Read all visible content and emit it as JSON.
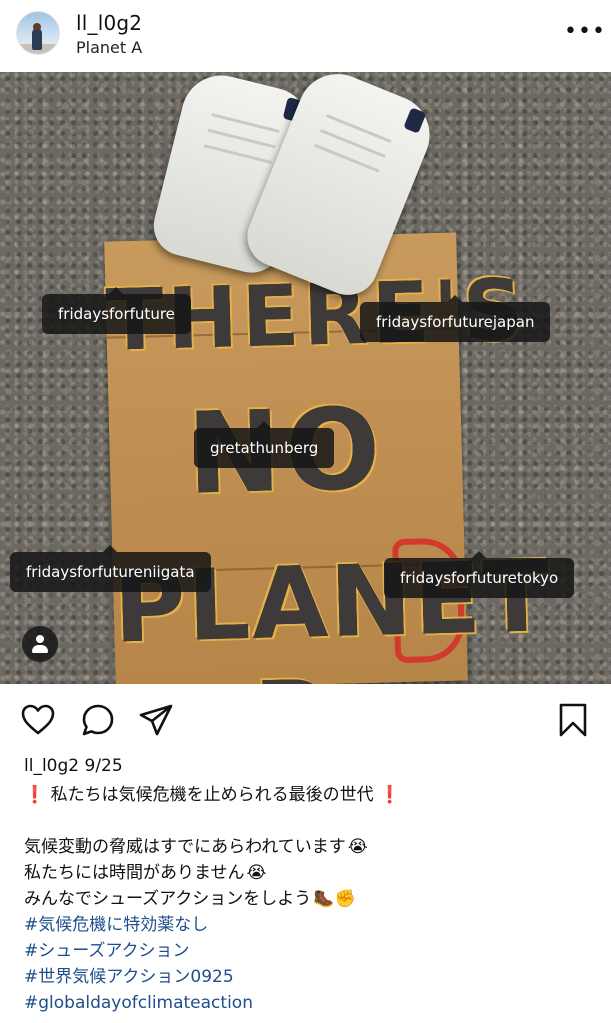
{
  "post": {
    "username": "ll_l0g2",
    "location": "Planet A",
    "more_label": "•••",
    "date": "9/25"
  },
  "photo": {
    "sign_lines": [
      "THERE'S",
      "NO",
      "PLANET B"
    ],
    "tags": [
      "fridaysforfuture",
      "fridaysforfuturejapan",
      "gretathunberg",
      "fridaysforfutureniigata",
      "fridaysforfuturetokyo"
    ],
    "user_tag_icon": "person-icon"
  },
  "actions": {
    "icons": [
      "heart-icon",
      "comment-icon",
      "share-icon",
      "bookmark-icon"
    ]
  },
  "caption": {
    "headline_mark": "❗",
    "headline": "私たちは気候危機を止められる最後の世代",
    "lines": [
      {
        "text": "気候変動の脅威はすでにあらわれています",
        "emoji": "😭"
      },
      {
        "text": "私たちには時間がありません",
        "emoji": "😭"
      },
      {
        "text": "みんなでシューズアクションをしよう",
        "emoji": "🥾✊"
      }
    ],
    "hashtags": [
      "#気候危機に特効薬なし",
      "#シューズアクション",
      "#世界気候アクション0925",
      "#globaldayofclimateaction"
    ]
  },
  "colors": {
    "hashtag": "#1e4f8c",
    "tag_bg": "#161616",
    "exclamation": "#d8262c"
  }
}
